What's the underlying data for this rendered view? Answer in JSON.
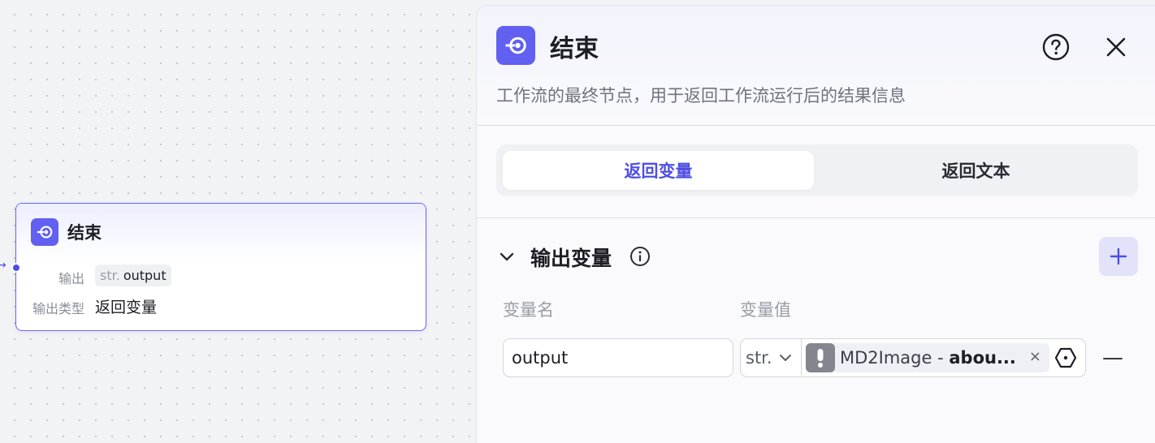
{
  "canvas": {
    "node": {
      "title": "结束",
      "output_label": "输出",
      "output_type_tag": "str.",
      "output_name": "output",
      "output_type_label": "输出类型",
      "output_type_value": "返回变量"
    }
  },
  "panel": {
    "title": "结束",
    "description": "工作流的最终节点，用于返回工作流运行后的结果信息",
    "tabs": [
      {
        "label": "返回变量",
        "active": true
      },
      {
        "label": "返回文本",
        "active": false
      }
    ],
    "section": {
      "title": "输出变量",
      "col_name_label": "变量名",
      "col_value_label": "变量值",
      "rows": [
        {
          "name": "output",
          "type": "str.",
          "ref_prefix": "MD2Image - ",
          "ref_name": "abou..."
        }
      ]
    }
  },
  "colors": {
    "accent": "#4e4ee6",
    "icon_bg": "#6160f0",
    "add_button_bg": "#e2e3fb"
  },
  "icons": [
    "end-node-icon",
    "help-icon",
    "close-icon",
    "chevron-down-icon",
    "info-icon",
    "plus-icon",
    "warning-icon",
    "remove-icon",
    "variable-icon",
    "minus-icon"
  ]
}
